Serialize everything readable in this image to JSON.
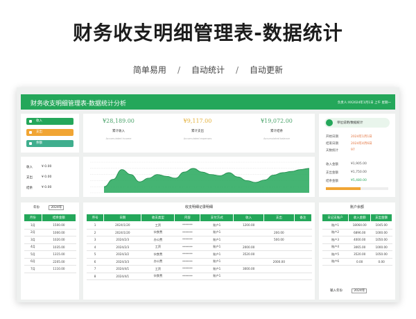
{
  "hero": {
    "title": "财务收支明细管理表-数据统计",
    "tags": [
      "简单易用",
      "自动统计",
      "自动更新"
    ]
  },
  "app": {
    "title": "财务收支明细管理表-数据统计分析",
    "user_label": "负责人:XX",
    "date_label": "2024年1月1日 上午 星期一"
  },
  "sidebar": {
    "buttons": [
      {
        "label": "收入",
        "color": "#24a75a"
      },
      {
        "label": "支出",
        "color": "#f1a534"
      },
      {
        "label": "余额",
        "color": "#3fae8e"
      }
    ],
    "summary": [
      {
        "label": "收入",
        "value": "¥ 0.00"
      },
      {
        "label": "支出",
        "value": "¥ 0.00"
      },
      {
        "label": "结余",
        "value": "¥ 0.00"
      }
    ]
  },
  "stats": [
    {
      "amount": "¥28,189.00",
      "label": "累计收入",
      "note": "Accumulated income",
      "color": "#4aa36a"
    },
    {
      "amount": "¥9,117.00",
      "label": "累计支出",
      "note": "Accumulated expenses",
      "color": "#e3b03a"
    },
    {
      "amount": "¥19,072.00",
      "label": "累计结余",
      "note": "Accumulated balance",
      "color": "#4aa36a"
    }
  ],
  "chart_data": {
    "type": "area",
    "x": [
      1,
      2,
      3,
      4,
      5,
      6,
      7,
      8,
      9,
      10,
      11,
      12,
      13,
      14,
      15,
      16,
      17,
      18,
      19,
      20,
      21,
      22,
      23,
      24
    ],
    "values": [
      10,
      22,
      38,
      30,
      18,
      24,
      30,
      27,
      24,
      34,
      40,
      34,
      30,
      28,
      33,
      26,
      20,
      17,
      21,
      29,
      33,
      35,
      38,
      40
    ],
    "ylim": [
      0,
      50
    ],
    "color": "#24a75a",
    "grid": true
  },
  "month_panel": {
    "year_label": "年份",
    "year_value": "2024年",
    "headers": [
      "月份",
      "结余金额"
    ],
    "rows": [
      [
        "1月",
        "1500.00"
      ],
      [
        "2月",
        "1000.00"
      ],
      [
        "3月",
        "1020.00"
      ],
      [
        "4月",
        "1035.00"
      ],
      [
        "5月",
        "1315.00"
      ],
      [
        "6月",
        "2205.00"
      ],
      [
        "7月",
        "1110.00"
      ]
    ]
  },
  "detail": {
    "title": "收支明细记录明细",
    "headers": [
      "序号",
      "日期",
      "收支类型",
      "内容",
      "支付方式",
      "收入",
      "支出",
      "备注"
    ],
    "rows": [
      [
        "1",
        "2024/1/20",
        "工资",
        "*******",
        "账户1",
        "1200.00",
        "",
        ""
      ],
      [
        "2",
        "2024/1/20",
        "伙食费",
        "*******",
        "账户1",
        "",
        "200.00",
        ""
      ],
      [
        "3",
        "2024/2/3",
        "办公费",
        "*******",
        "账户1",
        "",
        "500.00",
        ""
      ],
      [
        "4",
        "2024/2/3",
        "工资",
        "*******",
        "账户1",
        "2000.00",
        "",
        ""
      ],
      [
        "5",
        "2024/3/2",
        "伙食费",
        "*******",
        "账户1",
        "3520.00",
        "",
        ""
      ],
      [
        "6",
        "2024/3/3",
        "办公费",
        "*******",
        "账户1",
        "",
        "2000.00",
        ""
      ],
      [
        "7",
        "2024/4/1",
        "工资",
        "*******",
        "账户1",
        "3000.00",
        "",
        ""
      ],
      [
        "8",
        "2024/4/1",
        "伙食费",
        "*******",
        "账户1",
        "",
        "",
        ""
      ]
    ]
  },
  "right_panel": {
    "badge": "单位说明/数据统计",
    "info": [
      {
        "label": "开始日期",
        "value": "2024年1月1日",
        "color": "#e2703a"
      },
      {
        "label": "结束日期",
        "value": "2024年4月6日",
        "color": "#e2703a"
      },
      {
        "label": "天数统计",
        "value": "97",
        "color": "#e2703a"
      }
    ],
    "totals": [
      {
        "label": "收入金额",
        "value": "¥1,905.00"
      },
      {
        "label": "支出金额",
        "value": "¥1,750.00"
      },
      {
        "label": "结余金额",
        "value": "¥5,480.00"
      }
    ],
    "bar_fill": 0.55
  },
  "account_panel": {
    "title": "账户余额",
    "headers": [
      "日记支账户",
      "收入金额",
      "支出金额"
    ],
    "rows": [
      [
        "账户1",
        "18064.00",
        "1045.00"
      ],
      [
        "账户2",
        "6896.00",
        "1000.00"
      ],
      [
        "账户3",
        "4000.00",
        "1050.00"
      ],
      [
        "账户4",
        "3065.00",
        "1000.00"
      ],
      [
        "账户5",
        "3520.00",
        "1050.00"
      ],
      [
        "账户6",
        "0.00",
        "0.00"
      ]
    ],
    "footer_label": "输入年份",
    "footer_value": "2024年"
  }
}
